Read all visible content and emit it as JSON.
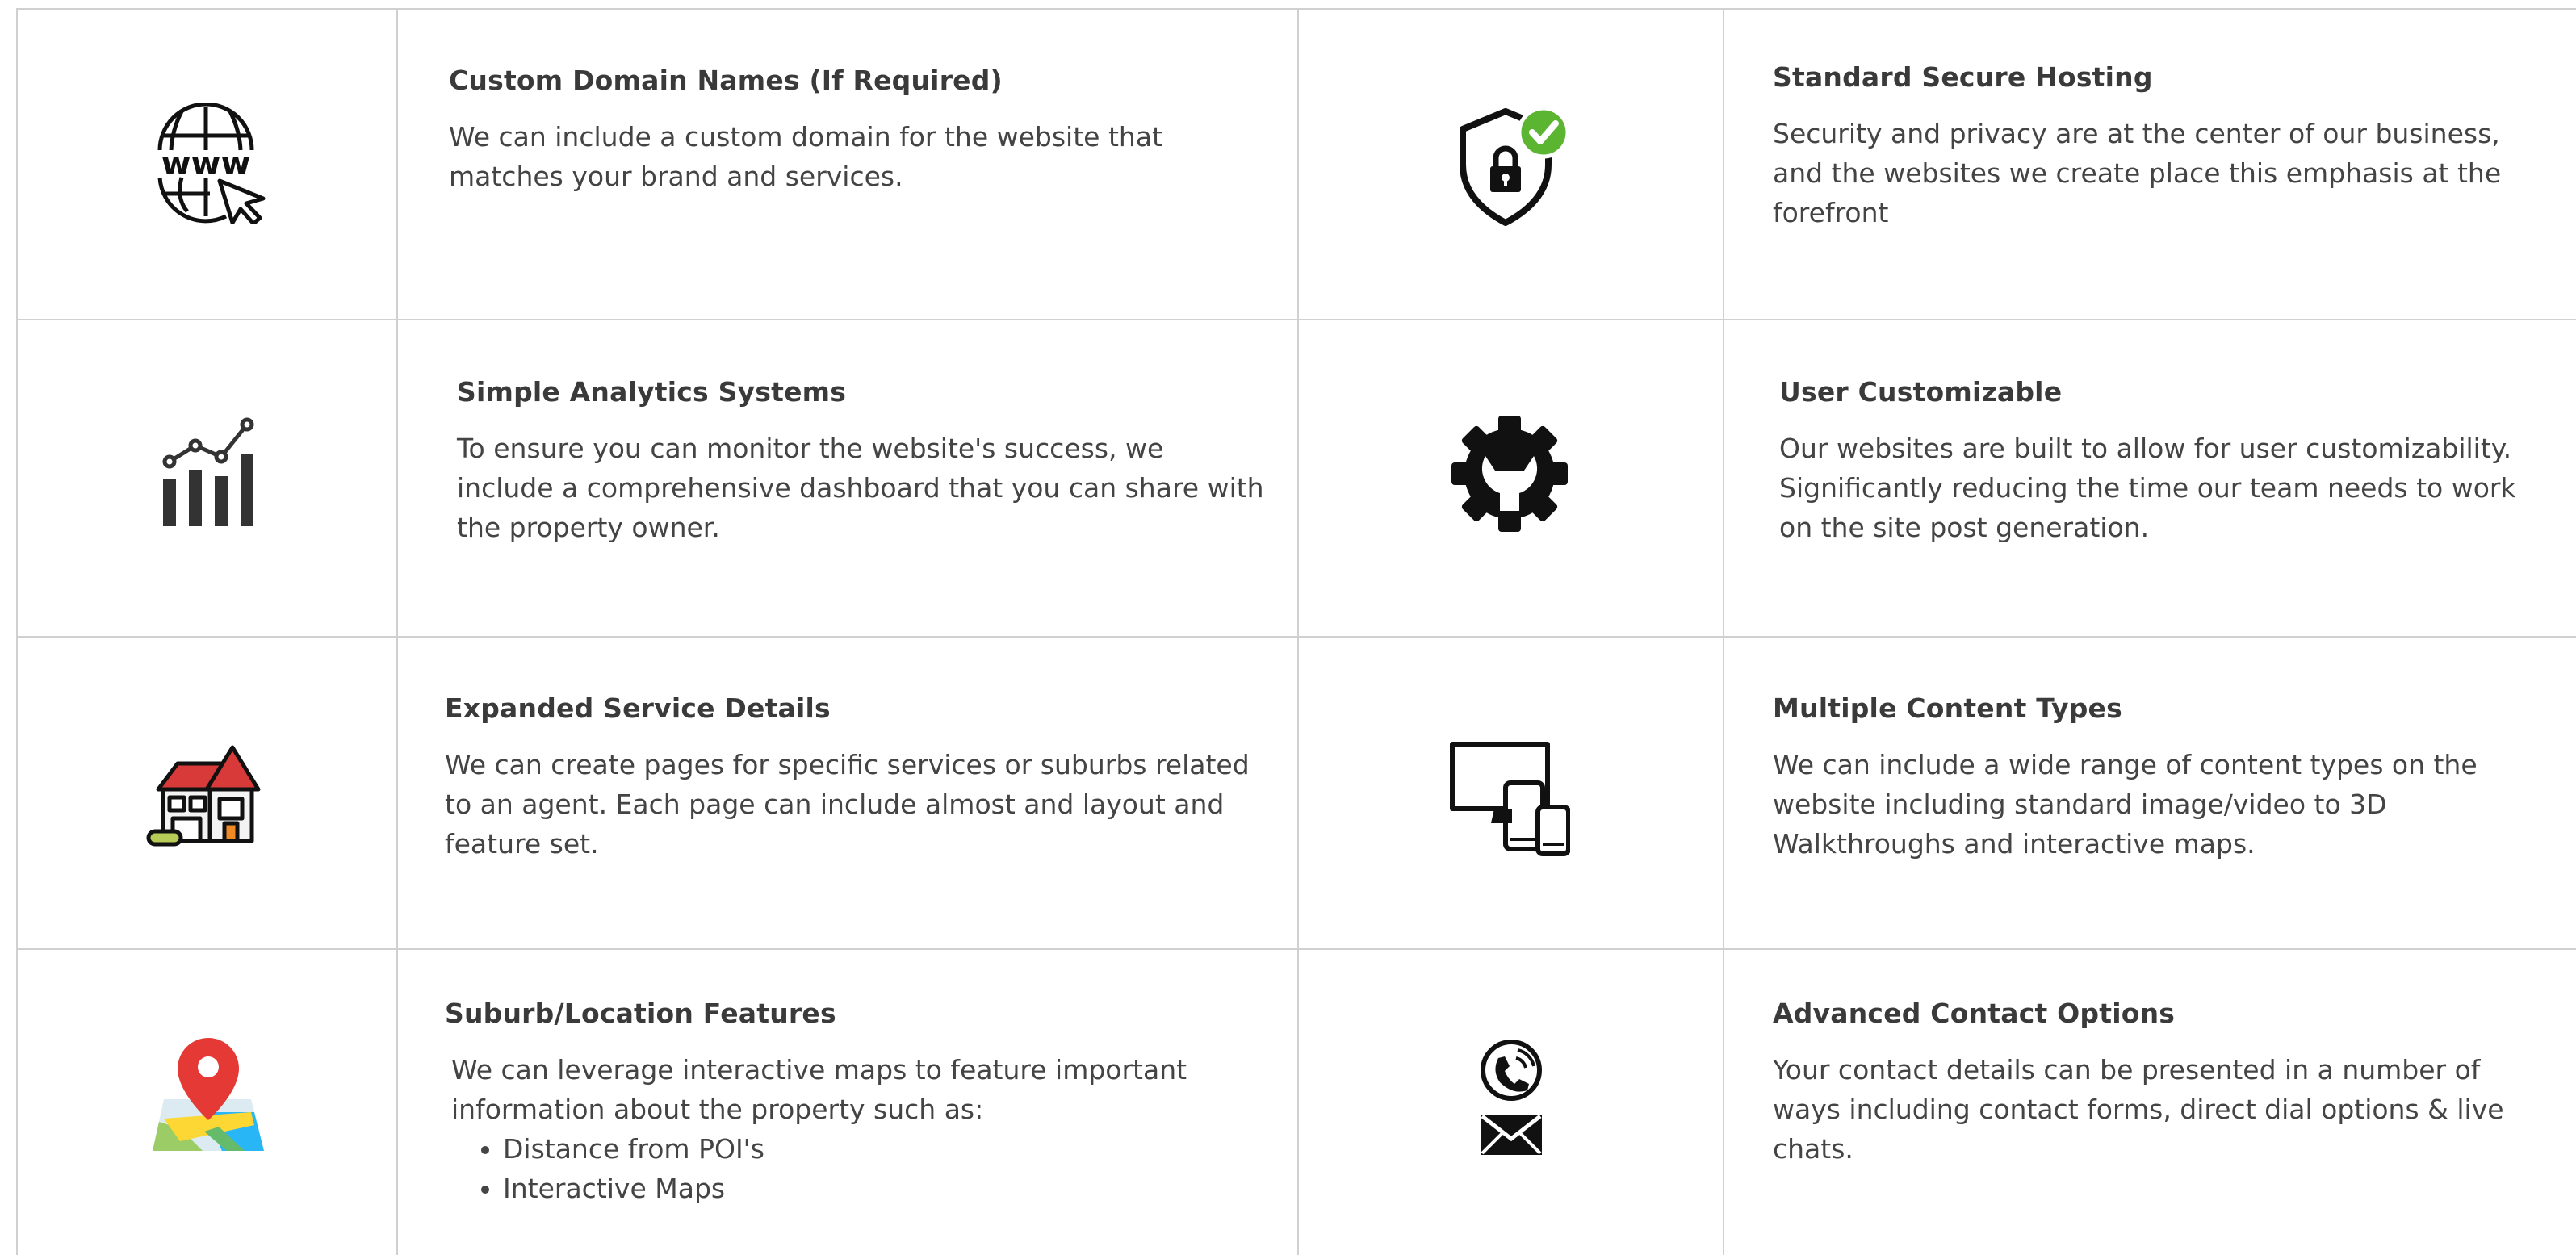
{
  "features": [
    {
      "title": "Custom Domain Names (If Required)",
      "text": "We can include a custom domain for the website that matches your brand and services.",
      "icon": "www-globe-cursor-icon"
    },
    {
      "title": "Standard Secure Hosting",
      "text": "Security and privacy are at the center of our business, and the websites we create place this emphasis at the forefront",
      "icon": "shield-lock-check-icon"
    },
    {
      "title": "Simple Analytics Systems",
      "text": "To ensure you can monitor the website's success, we include a comprehensive dashboard that you can share with the property owner.",
      "icon": "bar-chart-trend-icon"
    },
    {
      "title": "User Customizable",
      "text": "Our websites are built to allow for user customizability. Significantly reducing the time our team needs to work on the site post generation.",
      "icon": "gear-wrench-icon"
    },
    {
      "title": "Expanded Service Details",
      "text": "We can create pages for specific services or suburbs related to an agent. Each page can include almost and layout and feature set.",
      "icon": "house-icon"
    },
    {
      "title": "Multiple Content Types",
      "text": "We can include a wide range of content types on the website including standard image/video to 3D Walkthroughs and interactive maps.",
      "icon": "devices-icon"
    },
    {
      "title": "Suburb/Location Features",
      "text": "We can leverage interactive maps  to feature important information about the property such as:",
      "bullets": [
        "Distance from POI's",
        "Interactive Maps"
      ],
      "icon": "map-pin-icon"
    },
    {
      "title": "Advanced Contact Options",
      "text": "Your contact details can be presented in a number of ways including contact forms, direct dial options & live chats.",
      "icon": "phone-mail-icon"
    }
  ],
  "colors": {
    "grid": "#d0d0d0",
    "text": "#444444",
    "check_green": "#5cb531",
    "house_red": "#d83a3a",
    "pin_red": "#e53935"
  }
}
